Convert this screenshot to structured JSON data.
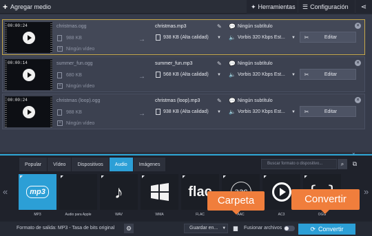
{
  "toolbar": {
    "add_media": "Agregar medio",
    "tools": "Herramientas",
    "settings": "Configuración"
  },
  "files": [
    {
      "duration": "00:00:24",
      "source_name": "christmas.ogg",
      "source_size": "988 KB",
      "no_video": "Ningún vídeo",
      "output_name": "christmas.mp3",
      "output_size": "938 KB (Alta calidad)",
      "subtitle": "Ningún subtítulo",
      "audio": "Vorbis 320 Kbps Est...",
      "edit": "Editar",
      "selected": true
    },
    {
      "duration": "00:00:14",
      "source_name": "summer_fun.ogg",
      "source_size": "680 KB",
      "no_video": "Ningún vídeo",
      "output_name": "summer_fun.mp3",
      "output_size": "568 KB (Alta calidad)",
      "subtitle": "Ningún subtítulo",
      "audio": "Vorbis 320 Kbps Est...",
      "edit": "Editar",
      "selected": false
    },
    {
      "duration": "00:00:24",
      "source_name": "christmas (loop).ogg",
      "source_size": "988 KB",
      "no_video": "Ningún vídeo",
      "output_name": "christmas (loop).mp3",
      "output_size": "938 KB (Alta calidad)",
      "subtitle": "Ningún subtítulo",
      "audio": "Vorbis 320 Kbps Est...",
      "edit": "Editar",
      "selected": false
    }
  ],
  "tabs": [
    "Popular",
    "Vídeo",
    "Dispositivos",
    "Audio",
    "Imágenes"
  ],
  "active_tab": "Audio",
  "search": {
    "placeholder": "Buscar formato o dispositivo..."
  },
  "formats": [
    {
      "name": "MP3",
      "icon": "mp3-logo-icon",
      "selected": true
    },
    {
      "name": "Audio para Apple",
      "icon": "apple-icon",
      "selected": false
    },
    {
      "name": "WAV",
      "icon": "music-note-icon",
      "selected": false
    },
    {
      "name": "WMA",
      "icon": "windows-icon",
      "selected": false
    },
    {
      "name": "FLAC",
      "icon": "flac-icon",
      "selected": false
    },
    {
      "name": "AAC",
      "icon": "aac-icon",
      "selected": false
    },
    {
      "name": "AC3",
      "icon": "ac3-icon",
      "selected": false
    },
    {
      "name": "OGG",
      "icon": "ogg-icon",
      "selected": false
    }
  ],
  "bottom": {
    "output_format": "Formato de salida: MP3 - Tasa de bits original",
    "save_to": "Guardar en...",
    "merge": "Fusionar archivos",
    "convert": "Convertir"
  },
  "callouts": {
    "folder": "Carpeta",
    "convert": "Convertir"
  },
  "colors": {
    "accent": "#2c9fd6",
    "callout": "#f07e3c",
    "selected_border": "#c7a94a"
  }
}
